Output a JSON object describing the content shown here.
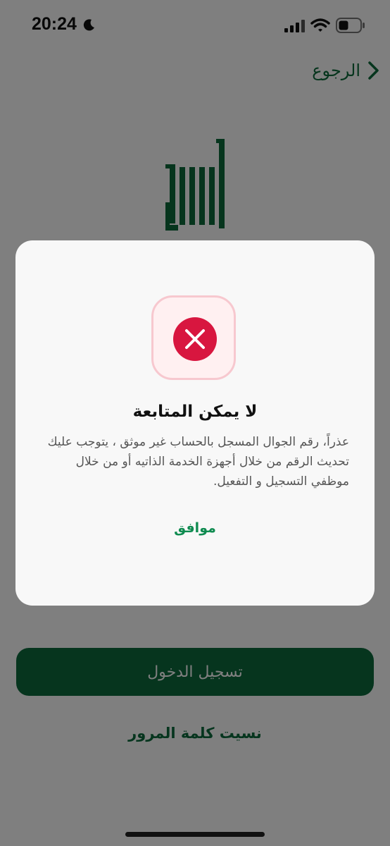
{
  "status_bar": {
    "time": "20:24",
    "icons": [
      "moon-icon",
      "signal-icon",
      "wifi-icon",
      "battery-icon"
    ]
  },
  "header": {
    "back_label": "الرجوع",
    "back_icon": "chevron-right-icon"
  },
  "logo": {
    "text": "أبشر",
    "color": "#0c6b3a"
  },
  "login": {
    "login_label": "تسجيل الدخول",
    "forgot_password_label": "نسيت كلمة المرور"
  },
  "dialog": {
    "icon": "error-x-icon",
    "title": "لا يمكن المتابعة",
    "message": "عذراً، رقم الجوال المسجل بالحساب غير موثق ، يتوجب عليك تحديث الرقم من خلال أجهزة الخدمة الذاتيه أو من خلال موظفي التسجيل و التفعيل.",
    "ok_label": "موافق"
  },
  "colors": {
    "brand_green": "#0d6b3d",
    "accent_green": "#0f8b50",
    "error_red": "#d8163f"
  }
}
